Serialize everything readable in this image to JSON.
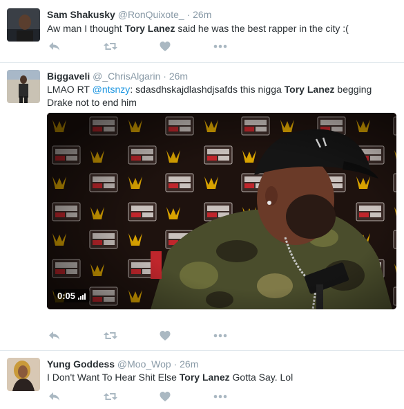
{
  "tweets": [
    {
      "name": "Sam Shakusky",
      "handle": "@RonQuixote_",
      "dot": "·",
      "time": "26m",
      "text_before": "Aw man I thought ",
      "bold": "Tory Lanez",
      "text_after": " said he was the best rapper in the city :("
    },
    {
      "name": "Biggaveli",
      "handle": "@_ChrisAlgarin",
      "dot": "·",
      "time": "26m",
      "text_prefix": "LMAO RT ",
      "mention": "@ntsnzy",
      "text_mid": ": sdasdhskajdlashdjsafds this nigga ",
      "bold": "Tory Lanez",
      "text_after": " begging Drake not to end him",
      "video": {
        "duration": "0:05",
        "backdrop_logos": [
          "POWER 106 FM",
          "REVOLT"
        ]
      }
    },
    {
      "name": "Yung Goddess",
      "handle": "@Moo_Wop",
      "dot": "·",
      "time": "26m",
      "text_before": "I Don't Want To Hear Shit Else ",
      "bold": "Tory Lanez",
      "text_after": " Gotta Say. Lol"
    }
  ],
  "icons": {
    "reply": "reply-icon",
    "retweet": "retweet-icon",
    "like": "heart-icon",
    "more": "more-icon"
  },
  "colors": {
    "name": "#292f33",
    "meta": "#8899a6",
    "link": "#1b95e0",
    "action": "#aab8c2",
    "divider": "#e1e8ed"
  }
}
